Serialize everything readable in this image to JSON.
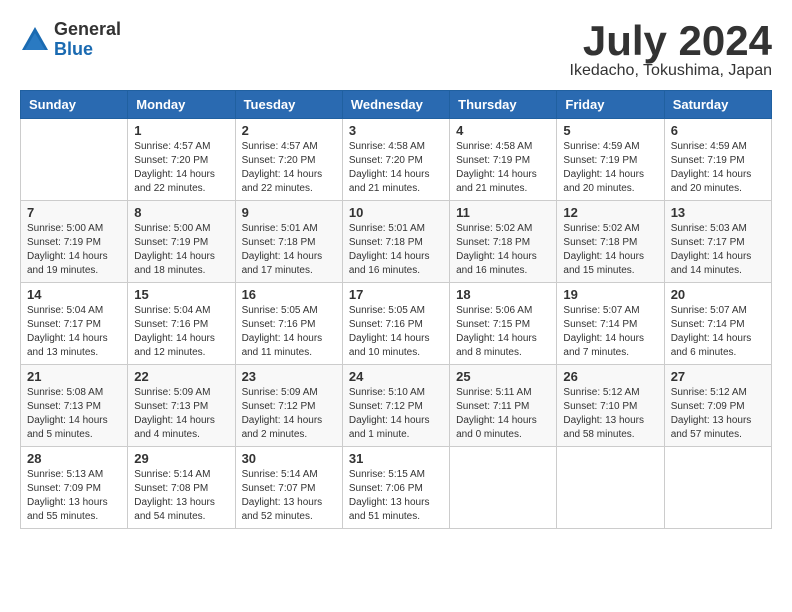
{
  "header": {
    "logo_general": "General",
    "logo_blue": "Blue",
    "month_title": "July 2024",
    "location": "Ikedacho, Tokushima, Japan"
  },
  "weekdays": [
    "Sunday",
    "Monday",
    "Tuesday",
    "Wednesday",
    "Thursday",
    "Friday",
    "Saturday"
  ],
  "weeks": [
    [
      {
        "day": "",
        "info": ""
      },
      {
        "day": "1",
        "info": "Sunrise: 4:57 AM\nSunset: 7:20 PM\nDaylight: 14 hours\nand 22 minutes."
      },
      {
        "day": "2",
        "info": "Sunrise: 4:57 AM\nSunset: 7:20 PM\nDaylight: 14 hours\nand 22 minutes."
      },
      {
        "day": "3",
        "info": "Sunrise: 4:58 AM\nSunset: 7:20 PM\nDaylight: 14 hours\nand 21 minutes."
      },
      {
        "day": "4",
        "info": "Sunrise: 4:58 AM\nSunset: 7:19 PM\nDaylight: 14 hours\nand 21 minutes."
      },
      {
        "day": "5",
        "info": "Sunrise: 4:59 AM\nSunset: 7:19 PM\nDaylight: 14 hours\nand 20 minutes."
      },
      {
        "day": "6",
        "info": "Sunrise: 4:59 AM\nSunset: 7:19 PM\nDaylight: 14 hours\nand 20 minutes."
      }
    ],
    [
      {
        "day": "7",
        "info": "Sunrise: 5:00 AM\nSunset: 7:19 PM\nDaylight: 14 hours\nand 19 minutes."
      },
      {
        "day": "8",
        "info": "Sunrise: 5:00 AM\nSunset: 7:19 PM\nDaylight: 14 hours\nand 18 minutes."
      },
      {
        "day": "9",
        "info": "Sunrise: 5:01 AM\nSunset: 7:18 PM\nDaylight: 14 hours\nand 17 minutes."
      },
      {
        "day": "10",
        "info": "Sunrise: 5:01 AM\nSunset: 7:18 PM\nDaylight: 14 hours\nand 16 minutes."
      },
      {
        "day": "11",
        "info": "Sunrise: 5:02 AM\nSunset: 7:18 PM\nDaylight: 14 hours\nand 16 minutes."
      },
      {
        "day": "12",
        "info": "Sunrise: 5:02 AM\nSunset: 7:18 PM\nDaylight: 14 hours\nand 15 minutes."
      },
      {
        "day": "13",
        "info": "Sunrise: 5:03 AM\nSunset: 7:17 PM\nDaylight: 14 hours\nand 14 minutes."
      }
    ],
    [
      {
        "day": "14",
        "info": "Sunrise: 5:04 AM\nSunset: 7:17 PM\nDaylight: 14 hours\nand 13 minutes."
      },
      {
        "day": "15",
        "info": "Sunrise: 5:04 AM\nSunset: 7:16 PM\nDaylight: 14 hours\nand 12 minutes."
      },
      {
        "day": "16",
        "info": "Sunrise: 5:05 AM\nSunset: 7:16 PM\nDaylight: 14 hours\nand 11 minutes."
      },
      {
        "day": "17",
        "info": "Sunrise: 5:05 AM\nSunset: 7:16 PM\nDaylight: 14 hours\nand 10 minutes."
      },
      {
        "day": "18",
        "info": "Sunrise: 5:06 AM\nSunset: 7:15 PM\nDaylight: 14 hours\nand 8 minutes."
      },
      {
        "day": "19",
        "info": "Sunrise: 5:07 AM\nSunset: 7:14 PM\nDaylight: 14 hours\nand 7 minutes."
      },
      {
        "day": "20",
        "info": "Sunrise: 5:07 AM\nSunset: 7:14 PM\nDaylight: 14 hours\nand 6 minutes."
      }
    ],
    [
      {
        "day": "21",
        "info": "Sunrise: 5:08 AM\nSunset: 7:13 PM\nDaylight: 14 hours\nand 5 minutes."
      },
      {
        "day": "22",
        "info": "Sunrise: 5:09 AM\nSunset: 7:13 PM\nDaylight: 14 hours\nand 4 minutes."
      },
      {
        "day": "23",
        "info": "Sunrise: 5:09 AM\nSunset: 7:12 PM\nDaylight: 14 hours\nand 2 minutes."
      },
      {
        "day": "24",
        "info": "Sunrise: 5:10 AM\nSunset: 7:12 PM\nDaylight: 14 hours\nand 1 minute."
      },
      {
        "day": "25",
        "info": "Sunrise: 5:11 AM\nSunset: 7:11 PM\nDaylight: 14 hours\nand 0 minutes."
      },
      {
        "day": "26",
        "info": "Sunrise: 5:12 AM\nSunset: 7:10 PM\nDaylight: 13 hours\nand 58 minutes."
      },
      {
        "day": "27",
        "info": "Sunrise: 5:12 AM\nSunset: 7:09 PM\nDaylight: 13 hours\nand 57 minutes."
      }
    ],
    [
      {
        "day": "28",
        "info": "Sunrise: 5:13 AM\nSunset: 7:09 PM\nDaylight: 13 hours\nand 55 minutes."
      },
      {
        "day": "29",
        "info": "Sunrise: 5:14 AM\nSunset: 7:08 PM\nDaylight: 13 hours\nand 54 minutes."
      },
      {
        "day": "30",
        "info": "Sunrise: 5:14 AM\nSunset: 7:07 PM\nDaylight: 13 hours\nand 52 minutes."
      },
      {
        "day": "31",
        "info": "Sunrise: 5:15 AM\nSunset: 7:06 PM\nDaylight: 13 hours\nand 51 minutes."
      },
      {
        "day": "",
        "info": ""
      },
      {
        "day": "",
        "info": ""
      },
      {
        "day": "",
        "info": ""
      }
    ]
  ]
}
